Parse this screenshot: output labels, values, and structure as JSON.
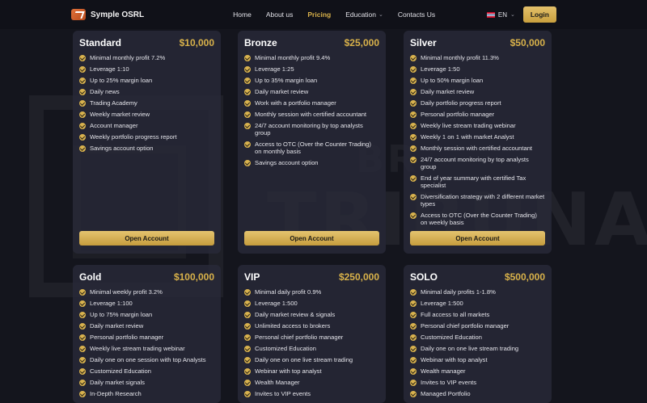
{
  "header": {
    "logo_text": "Symple OSRL",
    "nav": [
      {
        "label": "Home",
        "active": false,
        "dropdown": false
      },
      {
        "label": "About us",
        "active": false,
        "dropdown": false
      },
      {
        "label": "Pricing",
        "active": true,
        "dropdown": false
      },
      {
        "label": "Education",
        "active": false,
        "dropdown": true
      },
      {
        "label": "Contacts Us",
        "active": false,
        "dropdown": false
      }
    ],
    "language": "EN",
    "login_label": "Login"
  },
  "watermark": {
    "line1": "BR",
    "line2": "TRIBUNAL"
  },
  "plans": [
    {
      "name": "Standard",
      "price": "$10,000",
      "button": "Open Account",
      "features": [
        "Minimal monthly profit 7.2%",
        "Leverage 1:10",
        "Up to 25% margin loan",
        "Daily news",
        "Trading Academy",
        "Weekly market review",
        "Account manager",
        "Weekly portfolio progress report",
        "Savings account option"
      ]
    },
    {
      "name": "Bronze",
      "price": "$25,000",
      "button": "Open Account",
      "features": [
        "Minimal monthly profit 9.4%",
        "Leverage 1:25",
        "Up to 35% margin loan",
        "Daily market review",
        "Work with a portfolio manager",
        "Monthly session with certified accountant",
        "24/7 account monitoring by top analysts group",
        "Access to OTC (Over the Counter Trading) on monthly basis",
        "Savings account option"
      ]
    },
    {
      "name": "Silver",
      "price": "$50,000",
      "button": "Open Account",
      "features": [
        "Minimal monthly profit 11.3%",
        "Leverage 1:50",
        "Up to 50% margin loan",
        "Daily market review",
        "Daily portfolio progress report",
        "Personal portfolio manager",
        "Weekly live stream trading webinar",
        "Weekly 1 on 1 with market Analyst",
        "Monthly session with certified accountant",
        "24/7 account monitoring by top analysts group",
        "End of year summary with certified Tax specialist",
        "Diversification strategy with 2 different market types",
        "Access to OTC (Over the Counter Trading) on weekly basis"
      ]
    },
    {
      "name": "Gold",
      "price": "$100,000",
      "features": [
        "Minimal weekly profit 3.2%",
        "Leverage 1:100",
        "Up to 75% margin loan",
        "Daily market review",
        "Personal portfolio manager",
        "Weekly live stream trading webinar",
        "Daily one on one session with top Analysts",
        "Customized Education",
        "Daily market signals",
        "In-Depth Research"
      ]
    },
    {
      "name": "VIP",
      "price": "$250,000",
      "features": [
        "Minimal daily profit 0.9%",
        "Leverage 1:500",
        "Daily market review & signals",
        "Unlimited access to brokers",
        "Personal chief portfolio manager",
        "Customized Education",
        "Daily one on one live stream trading",
        "Webinar with top analyst",
        "Wealth Manager",
        "Invites to VIP events"
      ]
    },
    {
      "name": "SOLO",
      "price": "$500,000",
      "features": [
        "Minimal daily profits 1-1.8%",
        "Leverage 1:500",
        "Full access to all markets",
        "Personal chief portfolio manager",
        "Customized Education",
        "Daily one on one live stream trading",
        "Webinar with top analyst",
        "Wealth manager",
        "Invites to VIP events",
        "Managed Portfolio"
      ]
    }
  ]
}
